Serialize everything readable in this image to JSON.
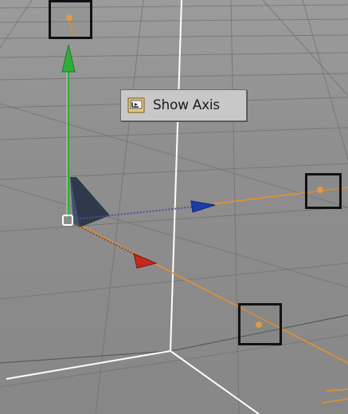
{
  "tooltip": {
    "label": "Show Axis",
    "icon": "show-axis-icon"
  },
  "colors": {
    "floor": "#8c8c8c",
    "grid_line": "#6e6e6e",
    "white_edge": "#ffffff",
    "orange_line": "#e8902a",
    "orange_handle": "#f2a03c",
    "y_axis": "#2fae3a",
    "z_axis": "#1a3ea8",
    "x_axis": "#c4281c",
    "camera_cone": "#243045",
    "tooltip_bg": "#c8c8c8"
  },
  "scene": {
    "handles": [
      "handle-top",
      "handle-right",
      "handle-bottom"
    ],
    "axes": [
      "y-axis-arrow",
      "z-axis-arrow",
      "x-axis-arrow"
    ]
  }
}
